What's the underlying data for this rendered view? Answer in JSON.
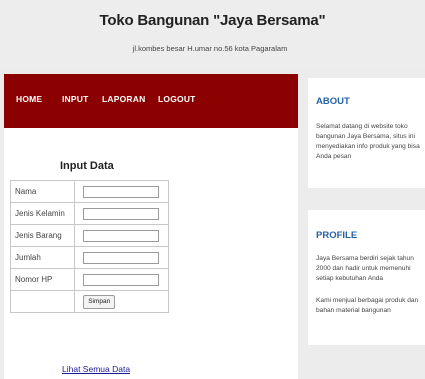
{
  "header": {
    "title": "Toko Bangunan \"Jaya Bersama\"",
    "address": "jl.kombes besar H.umar no.56 kota Pagaralam"
  },
  "nav": {
    "items": [
      {
        "label": "HOME"
      },
      {
        "label": "INPUT"
      },
      {
        "label": "LAPORAN"
      },
      {
        "label": "LOGOUT"
      }
    ]
  },
  "form": {
    "title": "Input Data",
    "fields": [
      {
        "label": "Nama",
        "value": ""
      },
      {
        "label": "Jenis Kelamin",
        "value": ""
      },
      {
        "label": "Jenis Barang",
        "value": ""
      },
      {
        "label": "Jumlah",
        "value": ""
      },
      {
        "label": "Nomor HP",
        "value": ""
      }
    ],
    "submit_label": "Simpan",
    "view_all_link": "Lihat Semua Data"
  },
  "sidebar": {
    "about": {
      "heading": "ABOUT",
      "text": "Selamat datang di website toko bangunan Jaya Bersama, situs ini menyediakan info produk yang bisa Anda pesan"
    },
    "profile": {
      "heading": "PROFILE",
      "text1": "Jaya Bersama berdiri sejak tahun 2000 dan hadir untuk memenuhi setiap kebutuhan Anda",
      "text2": "Kami menjual berbagai produk dan bahan material bangunan"
    }
  },
  "colors": {
    "nav_bg": "#8b0000",
    "heading_blue": "#2462a8",
    "link": "#1a1a9a"
  }
}
